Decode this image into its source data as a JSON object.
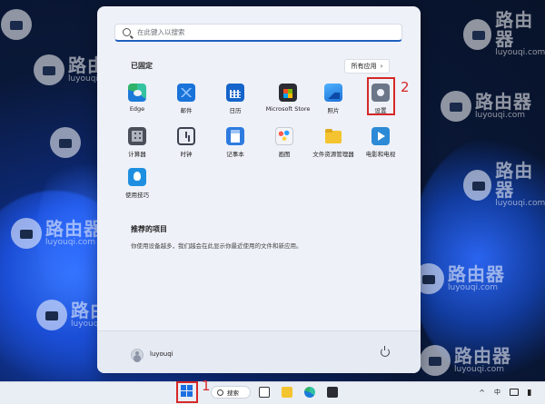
{
  "watermark": {
    "brand": "路由器",
    "site": "luyouqi.com"
  },
  "search": {
    "placeholder": "在此键入以搜索"
  },
  "pinned": {
    "title": "已固定",
    "all_apps_label": "所有应用",
    "apps": [
      {
        "label": "Edge",
        "icon": "edge-icon"
      },
      {
        "label": "邮件",
        "icon": "mail-icon"
      },
      {
        "label": "日历",
        "icon": "calendar-icon"
      },
      {
        "label": "Microsoft Store",
        "icon": "store-icon"
      },
      {
        "label": "照片",
        "icon": "photos-icon"
      },
      {
        "label": "设置",
        "icon": "gear-icon"
      },
      {
        "label": "计算器",
        "icon": "calculator-icon"
      },
      {
        "label": "时钟",
        "icon": "clock-icon"
      },
      {
        "label": "记事本",
        "icon": "notepad-icon"
      },
      {
        "label": "画图",
        "icon": "paint-icon"
      },
      {
        "label": "文件资源管理器",
        "icon": "folder-icon"
      },
      {
        "label": "电影和电视",
        "icon": "movies-icon"
      },
      {
        "label": "使用技巧",
        "icon": "tips-icon"
      }
    ]
  },
  "recommended": {
    "title": "推荐的项目",
    "description": "你使用设备越多，我们越会在此显示你最近使用的文件和新应用。"
  },
  "user": {
    "name": "luyouqi"
  },
  "annotations": {
    "step1": "1",
    "step2": "2",
    "highlight_color": "#d62828"
  },
  "taskbar": {
    "search_label": "搜索",
    "caret": "^",
    "language": "中"
  },
  "colors": {
    "accent": "#1b6fe0",
    "menu_bg": "#eef1f8"
  }
}
